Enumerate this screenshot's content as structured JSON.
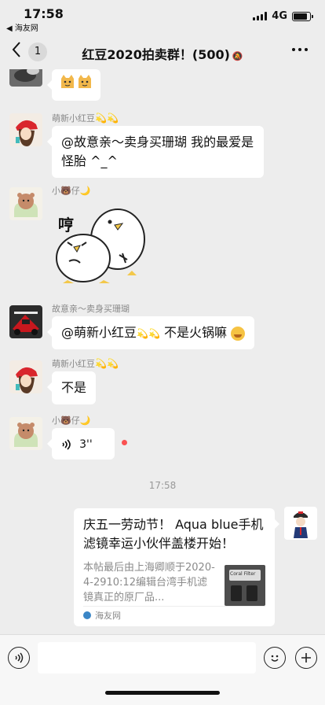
{
  "status_bar": {
    "time": "17:58",
    "back_app": "◀ 海友网",
    "network": "4G",
    "battery_level": 0.85
  },
  "nav": {
    "unread_count": "1",
    "title": "红豆2020拍卖群！(500)",
    "muted": true
  },
  "messages": [
    {
      "sender": "",
      "kind": "emoji"
    },
    {
      "sender": "萌新小红豆",
      "text": "@故意亲～卖身买珊瑚 我的最爱是怪胎 ^_^"
    },
    {
      "sender": "小🐻仔",
      "kind": "sticker",
      "sticker_text": "哼"
    },
    {
      "sender": "故意亲～卖身买珊瑚",
      "text_start": "@萌新小红豆",
      "text_end": " 不是火锅嘛"
    },
    {
      "sender": "萌新小红豆",
      "text": "不是"
    },
    {
      "sender": "小🐻仔",
      "kind": "voice",
      "duration": "3''",
      "unplayed": true
    }
  ],
  "timestamp": "17:58",
  "card": {
    "title": "庆五一劳动节！ Aqua blue手机滤镜幸运小伙伴盖楼开始！",
    "description": "本帖最后由上海卿顺于2020-4-2910:12编辑台湾手机滤镜真正的原厂品...",
    "thumb_label": "Coral Filter",
    "source": "海友网"
  },
  "input": {
    "placeholder": ""
  },
  "colors": {
    "background": "#ededed",
    "bubble": "#ffffff",
    "unread_dot": "#fa5151"
  }
}
